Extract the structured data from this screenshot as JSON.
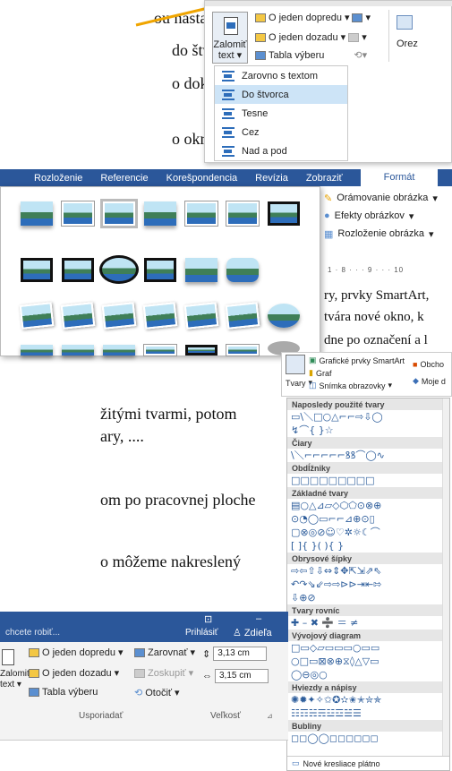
{
  "document": {
    "lines": [
      "ou nastavujeme",
      "do štvorca",
      "o dokumentu, text",
      "o okraja. Pri",
      "ry, prvky SmartArt,",
      "tvára nové okno, k",
      "dne po označení a l",
      "žitými tvarmi, potom",
      "ary, ....",
      "om po pracovnej ploche",
      "o môžeme nakreslený"
    ]
  },
  "wrap_panel": {
    "button_label_1": "Zalomiť",
    "button_label_2": "text",
    "forward": "O jeden dopredu",
    "backward": "O jeden dozadu",
    "selection": "Tabla výberu",
    "crop": "Orez",
    "menu": [
      "Zarovno s textom",
      "Do štvorca",
      "Tesne",
      "Cez",
      "Nad a pod"
    ]
  },
  "style_panel": {
    "tabs": [
      "Rozloženie",
      "Referencie",
      "Korešpondencia",
      "Revízia",
      "Zobraziť",
      "Formát"
    ],
    "active_tab": "Formát",
    "border": "Orámovanie obrázka",
    "effects": "Efekty obrázkov",
    "layout": "Rozloženie obrázka",
    "ruler": "1 · 8 · · · 9 · · · 10"
  },
  "insert_panel": {
    "smartart": "Grafické prvky SmartArt",
    "chart": "Graf",
    "screenshot": "Snímka obrazovky",
    "shapes": "Tvary",
    "store": "Obcho",
    "addins": "Moje d"
  },
  "shapes_panel": {
    "sections": [
      {
        "title": "Naposledy použité tvary",
        "rows": [
          "▭\\＼□○△⌐⌐⇨⇩◯",
          "↯⌒{ }☆"
        ]
      },
      {
        "title": "Čiary",
        "rows": [
          "\\＼⌐⌐⌐⌐⌐ꝸꝸ⌒◯∿"
        ]
      },
      {
        "title": "Obdĺžniky",
        "rows": [
          "□□□□□□□□□"
        ]
      },
      {
        "title": "Základné tvary",
        "rows": [
          "▤○△⊿▱◇⬡⬠⊙⊗⊕",
          "⊙◔◯▭⌐⌐⊿⊕⊙▯",
          "▢⊗◎⊘☺♡✲☼☾⌒",
          "[ ]{ }( ){ }"
        ]
      },
      {
        "title": "Obrysové šípky",
        "rows": [
          "⇨⇦⇧⇩⇔⇕✥⇱⇲⇗⇖",
          "↶↷⇘⇙⇨⇨⊳⊳⇥⇤⇰",
          "⇩⊕⊘"
        ]
      },
      {
        "title": "Tvary rovníc",
        "rows": [
          "✚ – ✖ ➗ ＝ ≠"
        ]
      },
      {
        "title": "Vývojový diagram",
        "rows": [
          "□▭◇▱▭▭▭○▭▭",
          "○□▭⊠⊗⊕⧖◊△▽▭",
          "◯⊖◎○"
        ]
      },
      {
        "title": "Hviezdy a nápisy",
        "rows": [
          "✺✹✦✧✩✪✫✬✭✮✯",
          "☷☶☵☴☳☲☱☰"
        ]
      },
      {
        "title": "Bubliny",
        "rows": [
          "◻◻◯◯◻◻◻◻◻◻"
        ]
      }
    ],
    "footer": "Nové kresliace plátno"
  },
  "bottom_ribbon": {
    "hint": "chcete robiť...",
    "signin": "Prihlásiť",
    "share": "Zdieľa",
    "forward": "O jeden dopredu",
    "backward": "O jeden dozadu",
    "selection": "Tabla výberu",
    "align": "Zarovnať",
    "group": "Zoskupiť",
    "rotate": "Otočiť",
    "height": "3,13 cm",
    "width": "3,15 cm",
    "wrap_1": "Zalomiť",
    "wrap_2": "text",
    "group_label": "Usporiadať",
    "size_label": "Veľkosť"
  }
}
